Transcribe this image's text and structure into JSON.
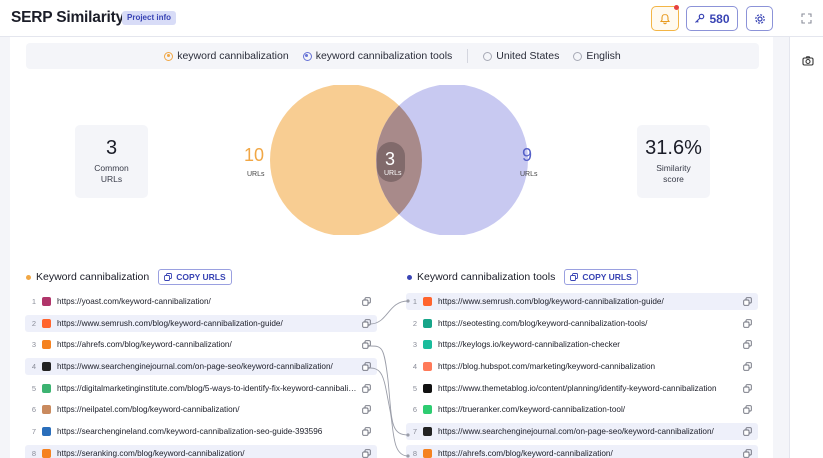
{
  "header": {
    "title": "SERP Similarity",
    "project_badge": "Project info",
    "credits": "580"
  },
  "filters": {
    "keyword1": "keyword cannibalization",
    "keyword2": "keyword cannibalization tools",
    "location": "United States",
    "language": "English"
  },
  "stats": {
    "common_value": "3",
    "common_label": "Common URLs",
    "similarity_value": "31.6%",
    "similarity_label": "Similarity score"
  },
  "venn": {
    "left_count": "10",
    "left_label": "URLs",
    "overlap_count": "3",
    "overlap_label": "URLs",
    "right_count": "9",
    "right_label": "URLs"
  },
  "colors": {
    "keyword1": "#f1a745",
    "keyword2": "#6672d6",
    "accent": "#3944b4"
  },
  "left_section": {
    "title": "Keyword cannibalization",
    "copy_label": "COPY URLS",
    "rows": [
      {
        "idx": "1",
        "url": "https://yoast.com/keyword-cannibalization/",
        "fav": "#b0356a"
      },
      {
        "idx": "2",
        "url": "https://www.semrush.com/blog/keyword-cannibalization-guide/",
        "fav": "#ff642d"
      },
      {
        "idx": "3",
        "url": "https://ahrefs.com/blog/keyword-cannibalization/",
        "fav": "#f58220"
      },
      {
        "idx": "4",
        "url": "https://www.searchenginejournal.com/on-page-seo/keyword-cannibalization/",
        "fav": "#222222"
      },
      {
        "idx": "5",
        "url": "https://digitalmarketinginstitute.com/blog/5-ways-to-identify-fix-keyword-cannibalization",
        "fav": "#3cb371"
      },
      {
        "idx": "6",
        "url": "https://neilpatel.com/blog/keyword-cannibalization/",
        "fav": "#c98a5e"
      },
      {
        "idx": "7",
        "url": "https://searchengineland.com/keyword-cannibalization-seo-guide-393596",
        "fav": "#2a6ebb"
      },
      {
        "idx": "8",
        "url": "https://seranking.com/blog/keyword-cannibalization/",
        "fav": "#f58220"
      }
    ]
  },
  "right_section": {
    "title": "Keyword cannibalization tools",
    "copy_label": "COPY URLS",
    "rows": [
      {
        "idx": "1",
        "url": "https://www.semrush.com/blog/keyword-cannibalization-guide/",
        "fav": "#ff642d"
      },
      {
        "idx": "2",
        "url": "https://seotesting.com/blog/keyword-cannibalization-tools/",
        "fav": "#17a589"
      },
      {
        "idx": "3",
        "url": "https://keylogs.io/keyword-cannibalization-checker",
        "fav": "#1abc9c"
      },
      {
        "idx": "4",
        "url": "https://blog.hubspot.com/marketing/keyword-cannibalization",
        "fav": "#ff7a59"
      },
      {
        "idx": "5",
        "url": "https://www.themetablog.io/content/planning/identify-keyword-cannibalization",
        "fav": "#111111"
      },
      {
        "idx": "6",
        "url": "https://trueranker.com/keyword-cannibalization-tool/",
        "fav": "#2ecc71"
      },
      {
        "idx": "7",
        "url": "https://www.searchenginejournal.com/on-page-seo/keyword-cannibalization/",
        "fav": "#222222"
      },
      {
        "idx": "8",
        "url": "https://ahrefs.com/blog/keyword-cannibalization/",
        "fav": "#f58220"
      }
    ]
  }
}
